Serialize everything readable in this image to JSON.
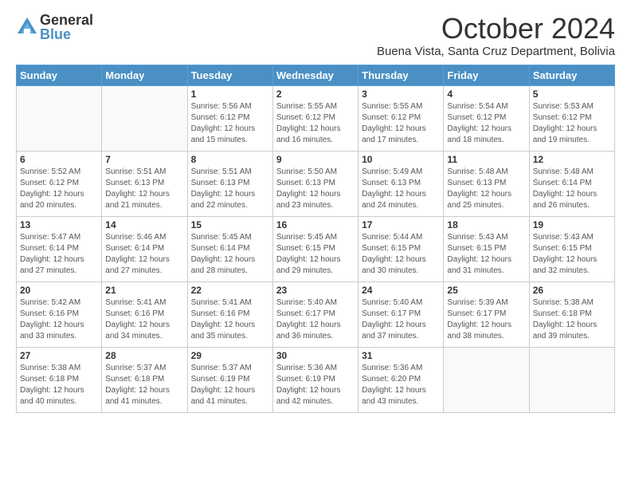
{
  "logo": {
    "general": "General",
    "blue": "Blue"
  },
  "title": "October 2024",
  "location": "Buena Vista, Santa Cruz Department, Bolivia",
  "weekdays": [
    "Sunday",
    "Monday",
    "Tuesday",
    "Wednesday",
    "Thursday",
    "Friday",
    "Saturday"
  ],
  "weeks": [
    [
      {
        "day": "",
        "info": ""
      },
      {
        "day": "",
        "info": ""
      },
      {
        "day": "1",
        "info": "Sunrise: 5:56 AM\nSunset: 6:12 PM\nDaylight: 12 hours and 15 minutes."
      },
      {
        "day": "2",
        "info": "Sunrise: 5:55 AM\nSunset: 6:12 PM\nDaylight: 12 hours and 16 minutes."
      },
      {
        "day": "3",
        "info": "Sunrise: 5:55 AM\nSunset: 6:12 PM\nDaylight: 12 hours and 17 minutes."
      },
      {
        "day": "4",
        "info": "Sunrise: 5:54 AM\nSunset: 6:12 PM\nDaylight: 12 hours and 18 minutes."
      },
      {
        "day": "5",
        "info": "Sunrise: 5:53 AM\nSunset: 6:12 PM\nDaylight: 12 hours and 19 minutes."
      }
    ],
    [
      {
        "day": "6",
        "info": "Sunrise: 5:52 AM\nSunset: 6:12 PM\nDaylight: 12 hours and 20 minutes."
      },
      {
        "day": "7",
        "info": "Sunrise: 5:51 AM\nSunset: 6:13 PM\nDaylight: 12 hours and 21 minutes."
      },
      {
        "day": "8",
        "info": "Sunrise: 5:51 AM\nSunset: 6:13 PM\nDaylight: 12 hours and 22 minutes."
      },
      {
        "day": "9",
        "info": "Sunrise: 5:50 AM\nSunset: 6:13 PM\nDaylight: 12 hours and 23 minutes."
      },
      {
        "day": "10",
        "info": "Sunrise: 5:49 AM\nSunset: 6:13 PM\nDaylight: 12 hours and 24 minutes."
      },
      {
        "day": "11",
        "info": "Sunrise: 5:48 AM\nSunset: 6:13 PM\nDaylight: 12 hours and 25 minutes."
      },
      {
        "day": "12",
        "info": "Sunrise: 5:48 AM\nSunset: 6:14 PM\nDaylight: 12 hours and 26 minutes."
      }
    ],
    [
      {
        "day": "13",
        "info": "Sunrise: 5:47 AM\nSunset: 6:14 PM\nDaylight: 12 hours and 27 minutes."
      },
      {
        "day": "14",
        "info": "Sunrise: 5:46 AM\nSunset: 6:14 PM\nDaylight: 12 hours and 27 minutes."
      },
      {
        "day": "15",
        "info": "Sunrise: 5:45 AM\nSunset: 6:14 PM\nDaylight: 12 hours and 28 minutes."
      },
      {
        "day": "16",
        "info": "Sunrise: 5:45 AM\nSunset: 6:15 PM\nDaylight: 12 hours and 29 minutes."
      },
      {
        "day": "17",
        "info": "Sunrise: 5:44 AM\nSunset: 6:15 PM\nDaylight: 12 hours and 30 minutes."
      },
      {
        "day": "18",
        "info": "Sunrise: 5:43 AM\nSunset: 6:15 PM\nDaylight: 12 hours and 31 minutes."
      },
      {
        "day": "19",
        "info": "Sunrise: 5:43 AM\nSunset: 6:15 PM\nDaylight: 12 hours and 32 minutes."
      }
    ],
    [
      {
        "day": "20",
        "info": "Sunrise: 5:42 AM\nSunset: 6:16 PM\nDaylight: 12 hours and 33 minutes."
      },
      {
        "day": "21",
        "info": "Sunrise: 5:41 AM\nSunset: 6:16 PM\nDaylight: 12 hours and 34 minutes."
      },
      {
        "day": "22",
        "info": "Sunrise: 5:41 AM\nSunset: 6:16 PM\nDaylight: 12 hours and 35 minutes."
      },
      {
        "day": "23",
        "info": "Sunrise: 5:40 AM\nSunset: 6:17 PM\nDaylight: 12 hours and 36 minutes."
      },
      {
        "day": "24",
        "info": "Sunrise: 5:40 AM\nSunset: 6:17 PM\nDaylight: 12 hours and 37 minutes."
      },
      {
        "day": "25",
        "info": "Sunrise: 5:39 AM\nSunset: 6:17 PM\nDaylight: 12 hours and 38 minutes."
      },
      {
        "day": "26",
        "info": "Sunrise: 5:38 AM\nSunset: 6:18 PM\nDaylight: 12 hours and 39 minutes."
      }
    ],
    [
      {
        "day": "27",
        "info": "Sunrise: 5:38 AM\nSunset: 6:18 PM\nDaylight: 12 hours and 40 minutes."
      },
      {
        "day": "28",
        "info": "Sunrise: 5:37 AM\nSunset: 6:18 PM\nDaylight: 12 hours and 41 minutes."
      },
      {
        "day": "29",
        "info": "Sunrise: 5:37 AM\nSunset: 6:19 PM\nDaylight: 12 hours and 41 minutes."
      },
      {
        "day": "30",
        "info": "Sunrise: 5:36 AM\nSunset: 6:19 PM\nDaylight: 12 hours and 42 minutes."
      },
      {
        "day": "31",
        "info": "Sunrise: 5:36 AM\nSunset: 6:20 PM\nDaylight: 12 hours and 43 minutes."
      },
      {
        "day": "",
        "info": ""
      },
      {
        "day": "",
        "info": ""
      }
    ]
  ]
}
